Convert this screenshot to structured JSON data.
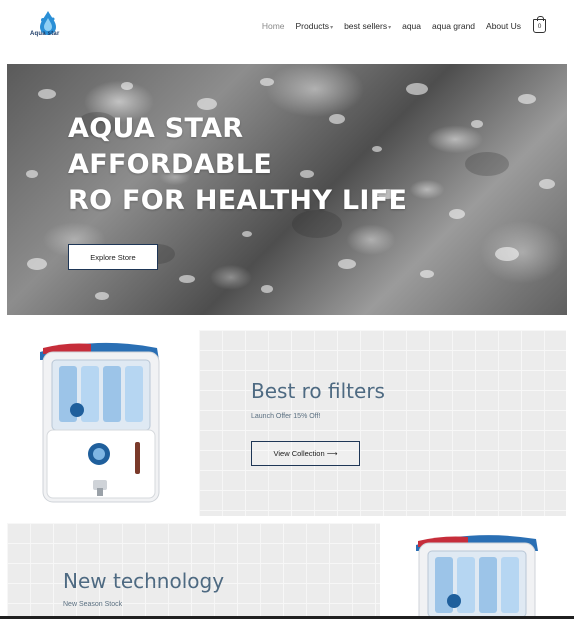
{
  "brand": {
    "name": "Aqua star"
  },
  "nav": {
    "items": [
      {
        "label": "Home",
        "active": true,
        "caret": false
      },
      {
        "label": "Products",
        "active": false,
        "caret": true
      },
      {
        "label": "best sellers",
        "active": false,
        "caret": true
      },
      {
        "label": "aqua",
        "active": false,
        "caret": false
      },
      {
        "label": "aqua grand",
        "active": false,
        "caret": false
      },
      {
        "label": "About Us",
        "active": false,
        "caret": false
      }
    ],
    "cart_count": "0"
  },
  "hero": {
    "title_lines": [
      "AQUA STAR",
      "AFFORDABLE",
      "RO FOR HEALTHY LIFE"
    ],
    "button_label": "Explore Store"
  },
  "promo1": {
    "title": "Best ro filters",
    "subtitle": "Launch Offer 15% Off!",
    "button_label": "View Collection ⟶"
  },
  "promo2": {
    "title": "New technology",
    "subtitle": "New Season Stock"
  },
  "colors": {
    "accent": "#1e3656",
    "promo_heading": "#4e6a82",
    "product_blue": "#2a6fb4",
    "product_red": "#c62d3a"
  },
  "icons": {
    "logo": "water-drop-logo",
    "cart": "shopping-bag-icon"
  }
}
